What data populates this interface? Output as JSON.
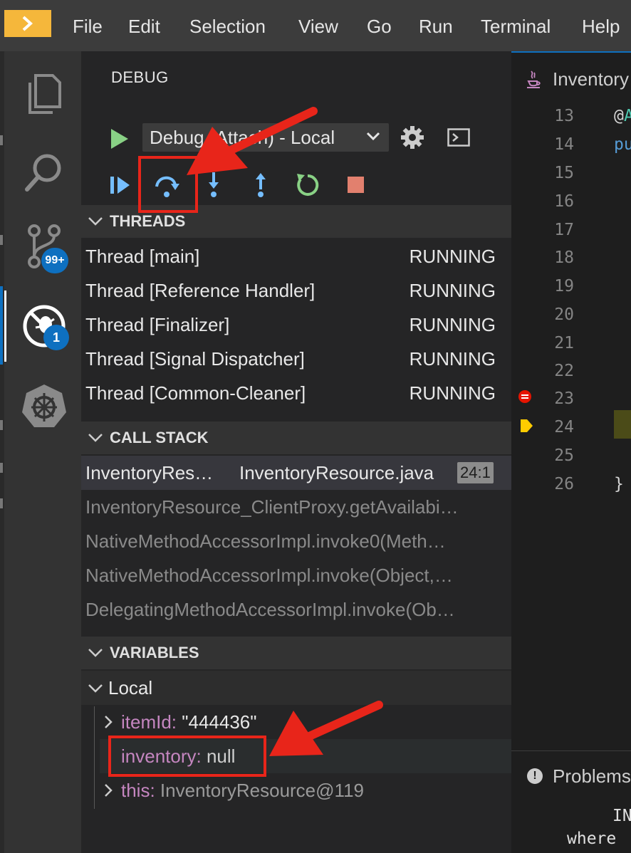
{
  "menubar": {
    "items": [
      "File",
      "Edit",
      "Selection",
      "View",
      "Go",
      "Run",
      "Terminal",
      "Help"
    ]
  },
  "activity": {
    "scm_badge": "99+",
    "debug_badge": "1"
  },
  "sidebar": {
    "title": "DEBUG",
    "config": "Debug (Attach) - Local"
  },
  "threads": {
    "title": "THREADS",
    "items": [
      {
        "name": "Thread [main]",
        "state": "RUNNING"
      },
      {
        "name": "Thread [Reference Handler]",
        "state": "RUNNING"
      },
      {
        "name": "Thread [Finalizer]",
        "state": "RUNNING"
      },
      {
        "name": "Thread [Signal Dispatcher]",
        "state": "RUNNING"
      },
      {
        "name": "Thread [Common-Cleaner]",
        "state": "RUNNING"
      }
    ]
  },
  "callstack": {
    "title": "CALL STACK",
    "current": {
      "fn": "InventoryRes…",
      "file": "InventoryResource.java",
      "pos": "24:1"
    },
    "frames": [
      "InventoryResource_ClientProxy.getAvailabi…",
      "NativeMethodAccessorImpl.invoke0(Meth…",
      "NativeMethodAccessorImpl.invoke(Object,…",
      "DelegatingMethodAccessorImpl.invoke(Ob…"
    ]
  },
  "variables": {
    "title": "VARIABLES",
    "scope": "Local",
    "items": [
      {
        "key": "itemId:",
        "value": "\"444436\""
      },
      {
        "key": "inventory:",
        "value": "null"
      },
      {
        "key": "this:",
        "value": "InventoryResource@119"
      }
    ]
  },
  "editor": {
    "tab_label": "Inventory",
    "line_numbers": [
      "13",
      "14",
      "15",
      "16",
      "17",
      "18",
      "19",
      "20",
      "21",
      "22",
      "23",
      "24",
      "25",
      "26"
    ],
    "code": {
      "l13_at": "@",
      "l13_rest": "A",
      "l14": "pu",
      "l26": "}"
    }
  },
  "panel": {
    "title": "Problems",
    "info_glyph": "!",
    "term_line1": "IN",
    "term_line2": "where"
  },
  "colors": {
    "accent": "#0e70c0",
    "annotation": "#e8251a",
    "logo": "#f5b73b",
    "variable_key": "#c586c0"
  }
}
